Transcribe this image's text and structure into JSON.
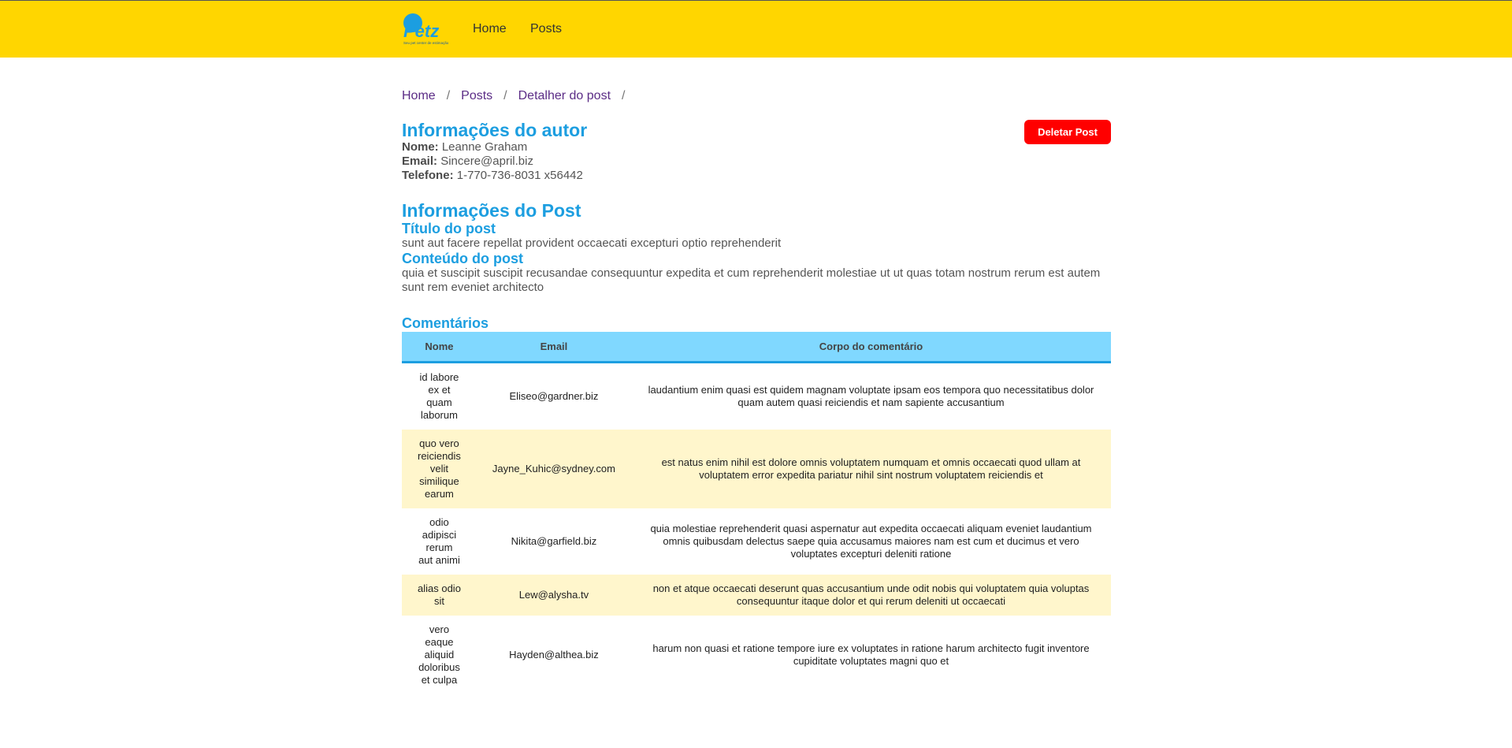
{
  "header": {
    "logo_text": "Petz",
    "logo_tagline": "Seu pet center de estimação",
    "nav": [
      {
        "label": "Home"
      },
      {
        "label": "Posts"
      }
    ]
  },
  "breadcrumb": {
    "items": [
      "Home",
      "Posts",
      "Detalher do post"
    ],
    "separator": "/"
  },
  "actions": {
    "delete_label": "Deletar Post"
  },
  "author": {
    "title": "Informações do autor",
    "name_label": "Nome:",
    "name": "Leanne Graham",
    "email_label": "Email:",
    "email": "Sincere@april.biz",
    "phone_label": "Telefone:",
    "phone": "1-770-736-8031 x56442"
  },
  "post": {
    "title": "Informações do Post",
    "post_title_heading": "Título do post",
    "post_title": "sunt aut facere repellat provident occaecati excepturi optio reprehenderit",
    "content_heading": "Conteúdo do post",
    "content": "quia et suscipit suscipit recusandae consequuntur expedita et cum reprehenderit molestiae ut ut quas totam nostrum rerum est autem sunt rem eveniet architecto"
  },
  "comments": {
    "title": "Comentários",
    "columns": [
      "Nome",
      "Email",
      "Corpo do comentário"
    ],
    "rows": [
      {
        "name": "id labore ex et quam laborum",
        "email": "Eliseo@gardner.biz",
        "body": "laudantium enim quasi est quidem magnam voluptate ipsam eos tempora quo necessitatibus dolor quam autem quasi reiciendis et nam sapiente accusantium"
      },
      {
        "name": "quo vero reiciendis velit similique earum",
        "email": "Jayne_Kuhic@sydney.com",
        "body": "est natus enim nihil est dolore omnis voluptatem numquam et omnis occaecati quod ullam at voluptatem error expedita pariatur nihil sint nostrum voluptatem reiciendis et"
      },
      {
        "name": "odio adipisci rerum aut animi",
        "email": "Nikita@garfield.biz",
        "body": "quia molestiae reprehenderit quasi aspernatur aut expedita occaecati aliquam eveniet laudantium omnis quibusdam delectus saepe quia accusamus maiores nam est cum et ducimus et vero voluptates excepturi deleniti ratione"
      },
      {
        "name": "alias odio sit",
        "email": "Lew@alysha.tv",
        "body": "non et atque occaecati deserunt quas accusantium unde odit nobis qui voluptatem quia voluptas consequuntur itaque dolor et qui rerum deleniti ut occaecati"
      },
      {
        "name": "vero eaque aliquid doloribus et culpa",
        "email": "Hayden@althea.biz",
        "body": "harum non quasi et ratione tempore iure ex voluptates in ratione harum architecto fugit inventore cupiditate voluptates magni quo et"
      }
    ]
  },
  "colors": {
    "header_bg": "#ffd600",
    "accent": "#1c9ee0",
    "danger": "#ff0000",
    "table_header": "#80d8ff",
    "row_alt": "#fff6cc",
    "link": "#5b2c86"
  }
}
